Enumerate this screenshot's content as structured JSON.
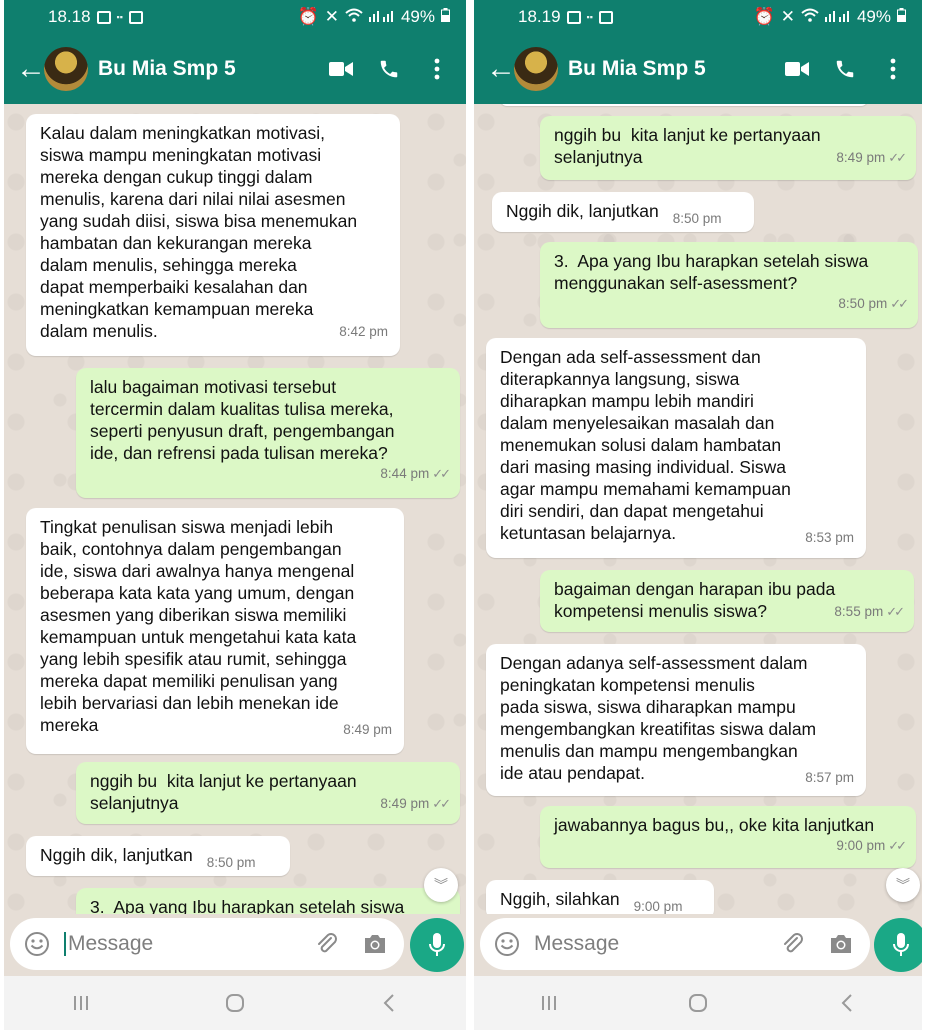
{
  "screens": [
    {
      "status": {
        "time": "18.18",
        "battery": "49%"
      },
      "contact_name": "Bu Mia Smp 5",
      "input_placeholder": "Message",
      "messages": [
        {
          "dir": "in",
          "text": "Kalau dalam meningkatkan motivasi,\nsiswa mampu meningkatan motivasi\nmereka dengan cukup tinggi dalam\nmenulis, karena dari nilai nilai asesmen\nyang sudah diisi, siswa bisa menemukan\nhambatan dan kekurangan mereka\ndalam menulis, sehingga mereka\ndapat memperbaiki kesalahan dan\nmeningkatkan kemampuan mereka\ndalam menulis.",
          "time": "8:42 pm"
        },
        {
          "dir": "out",
          "text": "lalu bagaiman motivasi tersebut\ntercermin dalam kualitas tulisa mereka,\nseperti penyusun draft, pengembangan\nide, dan refrensi pada tulisan mereka?",
          "time": "8:44 pm"
        },
        {
          "dir": "in",
          "text": "Tingkat penulisan siswa menjadi lebih\nbaik, contohnya dalam pengembangan\nide, siswa dari awalnya hanya mengenal\nbeberapa kata kata yang umum, dengan\nasesmen yang diberikan siswa memiliki\nkemampuan untuk mengetahui kata kata\nyang lebih spesifik atau rumit, sehingga\nmereka dapat memiliki penulisan yang\nlebih bervariasi dan lebih menekan ide\nmereka",
          "time": "8:49 pm"
        },
        {
          "dir": "out",
          "text": "nggih bu  kita lanjut ke pertanyaan\nselanjutnya",
          "time": "8:49 pm"
        },
        {
          "dir": "in",
          "text": "Nggih dik, lanjutkan",
          "time": "8:50 pm"
        },
        {
          "dir": "out",
          "text": "3.  Apa yang Ibu harapkan setelah siswa",
          "time": ""
        }
      ]
    },
    {
      "status": {
        "time": "18.19",
        "battery": "49%"
      },
      "contact_name": "Bu Mia Smp 5",
      "input_placeholder": "Message",
      "messages": [
        {
          "dir": "out",
          "text": "nggih bu  kita lanjut ke pertanyaan\nselanjutnya",
          "time": "8:49 pm"
        },
        {
          "dir": "in",
          "text": "Nggih dik, lanjutkan",
          "time": "8:50 pm"
        },
        {
          "dir": "out",
          "text": "3.  Apa yang Ibu harapkan setelah siswa\nmenggunakan self-asessment?",
          "time": "8:50 pm"
        },
        {
          "dir": "in",
          "text": "Dengan ada self-assessment dan\nditerapkannya langsung, siswa\ndiharapkan mampu lebih mandiri\ndalam menyelesaikan masalah dan\nmenemukan solusi dalam hambatan\ndari masing masing individual. Siswa\nagar mampu memahami kemampuan\ndiri sendiri, dan dapat mengetahui\nketuntasan belajarnya.",
          "time": "8:53 pm"
        },
        {
          "dir": "out",
          "text": "bagaiman dengan harapan ibu pada\nkompetensi menulis siswa?",
          "time": "8:55 pm"
        },
        {
          "dir": "in",
          "text": "Dengan adanya self-assessment dalam\npeningkatan kompetensi menulis\npada siswa, siswa diharapkan mampu\nmengembangkan kreatifitas siswa dalam\nmenulis dan mampu mengembangkan\nide atau pendapat.",
          "time": "8:57 pm"
        },
        {
          "dir": "out",
          "text": "jawabannya bagus bu,, oke kita lanjutkan",
          "time": "9:00 pm"
        },
        {
          "dir": "in",
          "text": "Nggih, silahkan",
          "time": "9:00 pm"
        }
      ]
    }
  ]
}
